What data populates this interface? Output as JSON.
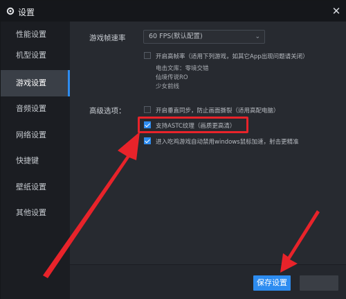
{
  "window": {
    "title": "设置",
    "close_glyph": "✕"
  },
  "sidebar": {
    "items": [
      {
        "label": "性能设置"
      },
      {
        "label": "机型设置"
      },
      {
        "label": "游戏设置",
        "active": true
      },
      {
        "label": "音频设置"
      },
      {
        "label": "网络设置"
      },
      {
        "label": "快捷键"
      },
      {
        "label": "壁纸设置"
      },
      {
        "label": "其他设置"
      }
    ]
  },
  "main": {
    "fps": {
      "label": "游戏帧速率",
      "value": "60 FPS(默认配置)"
    },
    "high_fps": {
      "label": "开启高帧率（适用下列游戏，如其它App出现问题请关闭）",
      "checked": false,
      "games": [
        "电击文库：零境交错",
        "仙境传说RO",
        "少女前线"
      ]
    },
    "advanced": {
      "label": "高级选项：",
      "options": [
        {
          "label": "开启垂直同步，防止画面撕裂（适用高配电脑）",
          "checked": false
        },
        {
          "label": "支持ASTC纹理（画质更高清）",
          "checked": true
        },
        {
          "label": "进入吃鸡游戏自动禁用windows鼠标加速，射击更精准",
          "checked": true
        }
      ]
    }
  },
  "footer": {
    "save_label": "保存设置",
    "cancel_label": ""
  },
  "colors": {
    "accent": "#2d8cf0",
    "annotation": "#e8232a"
  },
  "icons": {
    "title": "gear-icon",
    "select": "chevron-down-icon"
  }
}
